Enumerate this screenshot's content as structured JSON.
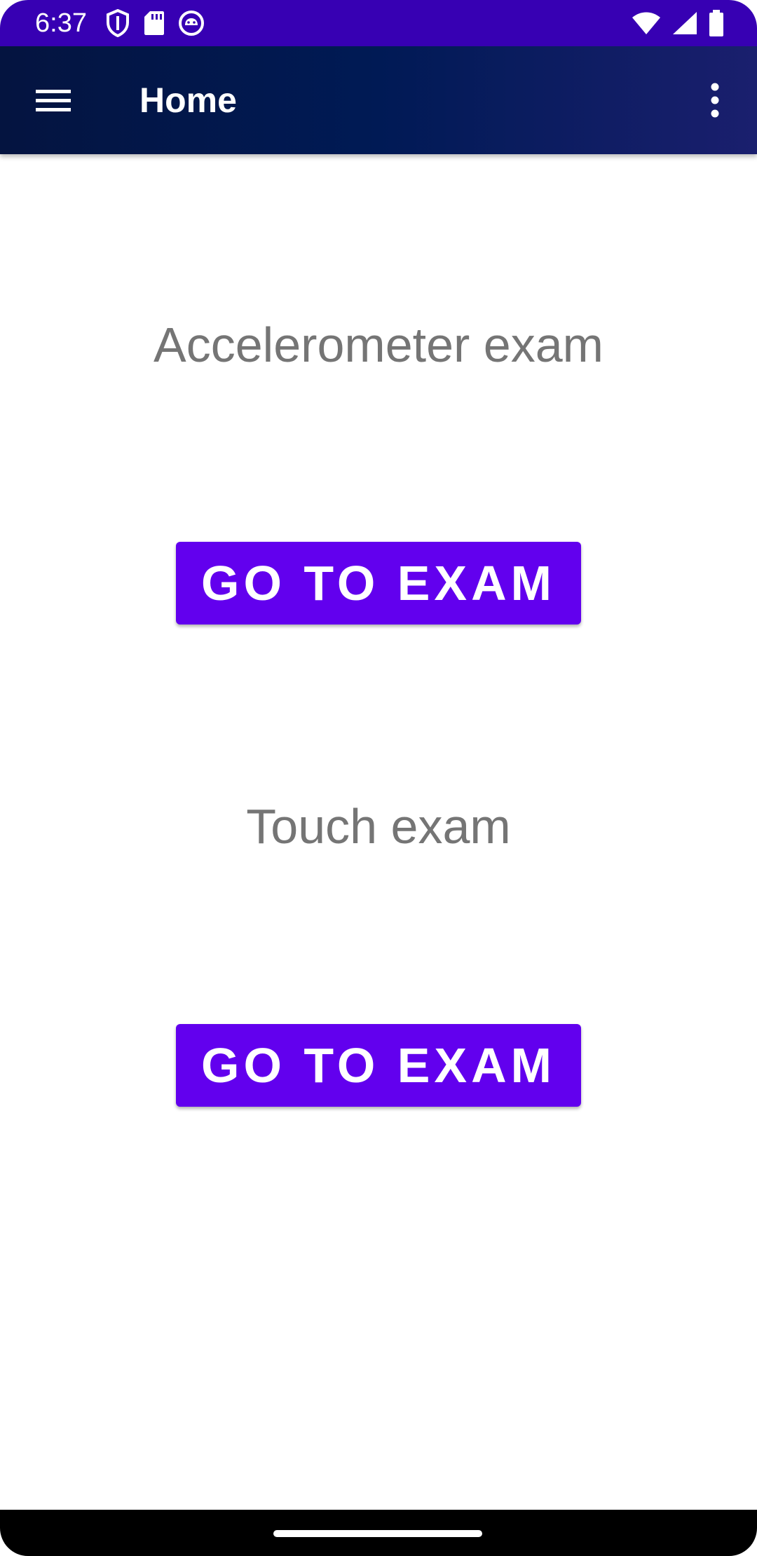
{
  "status_bar": {
    "time": "6:37",
    "left_icons": [
      "shield-icon",
      "sd-card-icon",
      "android-debug-icon"
    ],
    "right_icons": [
      "wifi-icon",
      "cell-signal-icon",
      "battery-icon"
    ],
    "color": "#3700b3"
  },
  "app_bar": {
    "title": "Home",
    "menu_icon": "hamburger-menu-icon",
    "overflow_icon": "more-vert-icon"
  },
  "main": {
    "sections": [
      {
        "label": "Accelerometer exam",
        "button_label": "GO TO EXAM"
      },
      {
        "label": "Touch exam",
        "button_label": "GO TO EXAM"
      }
    ]
  },
  "colors": {
    "primary": "#6200ee",
    "primary_dark": "#3700b3",
    "label_text": "#757575",
    "app_bar_bg": "#001a55"
  }
}
